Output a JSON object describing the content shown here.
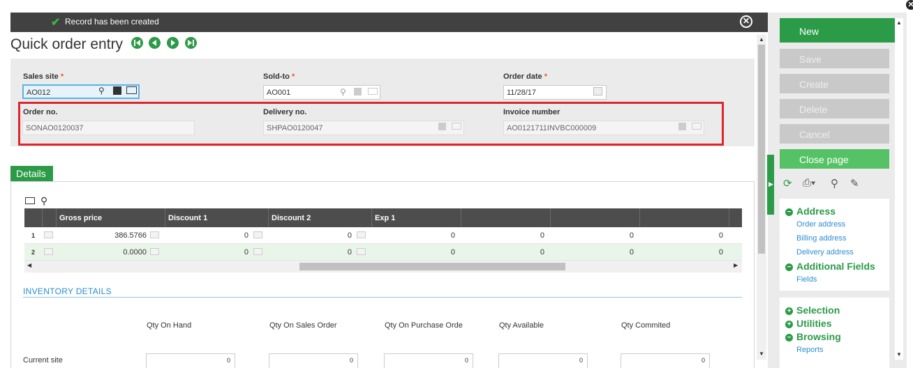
{
  "notification": {
    "message": "Record has been created"
  },
  "page": {
    "title": "Quick order entry"
  },
  "header": {
    "sales_site": {
      "label": "Sales site",
      "required": "*",
      "value": "AO012"
    },
    "sold_to": {
      "label": "Sold-to",
      "required": "*",
      "value": "AO001"
    },
    "order_date": {
      "label": "Order date",
      "required": "*",
      "value": "11/28/17"
    },
    "order_no": {
      "label": "Order no.",
      "value": "SONAO0120037"
    },
    "delivery_no": {
      "label": "Delivery no.",
      "value": "SHPAO0120047"
    },
    "invoice_number": {
      "label": "Invoice number",
      "value": "AO0121711INVBC000009"
    }
  },
  "details": {
    "tab_label": "Details",
    "columns": [
      "Gross price",
      "Discount 1",
      "Discount 2",
      "Exp 1",
      "",
      "",
      ""
    ],
    "rows": [
      {
        "num": "1",
        "gross": "386.5766",
        "d1": "0",
        "d2": "0",
        "e1": "0",
        "c5": "0",
        "c6": "0",
        "c7": "0"
      },
      {
        "num": "2",
        "gross": "0.0000",
        "d1": "0",
        "d2": "0",
        "e1": "0",
        "c5": "0",
        "c6": "0",
        "c7": "0"
      }
    ]
  },
  "inventory": {
    "title": "INVENTORY DETAILS",
    "headers": [
      "Qty On Hand",
      "Qty On Sales Order",
      "Qty On Purchase Orde",
      "Qty Available",
      "Qty Commited"
    ],
    "row_label": "Current site",
    "values": [
      "0",
      "0",
      "0",
      "0",
      "0"
    ]
  },
  "actions": {
    "new": "New",
    "save": "Save",
    "create": "Create",
    "delete": "Delete",
    "cancel": "Cancel",
    "close_page": "Close page"
  },
  "sections": {
    "address": {
      "title": "Address",
      "links": [
        "Order address",
        "Billing address",
        "Delivery address"
      ]
    },
    "additional_fields": {
      "title": "Additional Fields",
      "links": [
        "Fields"
      ]
    },
    "selection": {
      "title": "Selection"
    },
    "utilities": {
      "title": "Utilities"
    },
    "browsing": {
      "title": "Browsing",
      "links": [
        "Reports"
      ]
    }
  },
  "colors": {
    "accent": "#2b9b48",
    "highlight_border": "#e0252b",
    "link": "#2a8dd4",
    "notification_bg": "#414141"
  }
}
